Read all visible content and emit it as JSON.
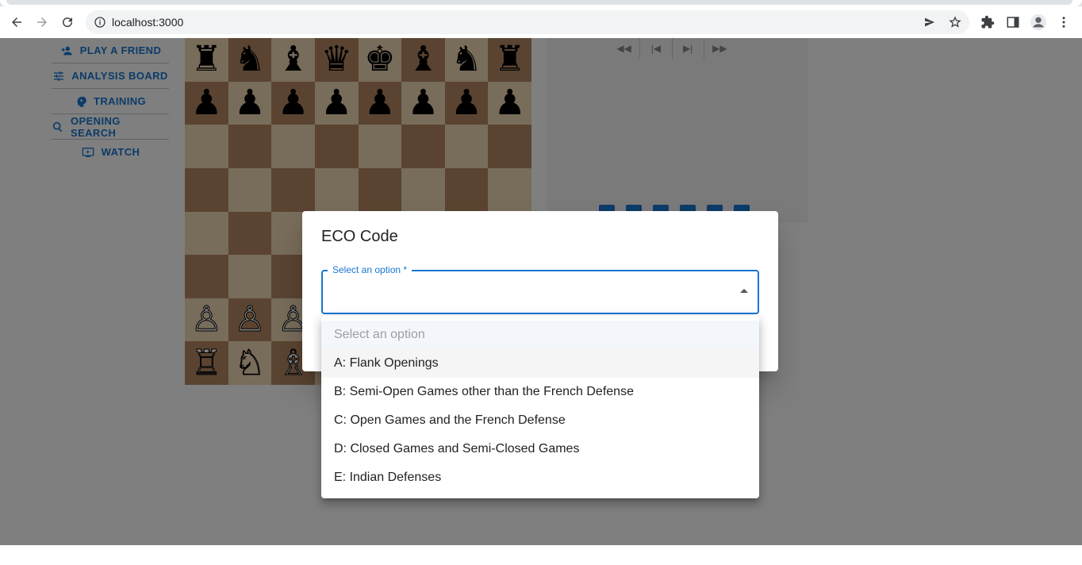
{
  "browser": {
    "url": "localhost:3000"
  },
  "sidebar": {
    "items": [
      {
        "label": "PLAY A FRIEND",
        "icon": "person-add-icon"
      },
      {
        "label": "ANALYSIS BOARD",
        "icon": "tune-icon"
      },
      {
        "label": "TRAINING",
        "icon": "psychology-icon"
      },
      {
        "label": "OPENING SEARCH",
        "icon": "search-icon"
      },
      {
        "label": "WATCH",
        "icon": "ondemand-video-icon"
      }
    ]
  },
  "board": {
    "light_color": "#f0d9b5",
    "dark_color": "#b58863",
    "rows": [
      [
        "♜",
        "♞",
        "♝",
        "♛",
        "♚",
        "♝",
        "♞",
        "♜"
      ],
      [
        "♟",
        "♟",
        "♟",
        "♟",
        "♟",
        "♟",
        "♟",
        "♟"
      ],
      [
        "",
        "",
        "",
        "",
        "",
        "",
        "",
        ""
      ],
      [
        "",
        "",
        "",
        "",
        "",
        "",
        "",
        ""
      ],
      [
        "",
        "",
        "",
        "",
        "",
        "",
        "",
        ""
      ],
      [
        "",
        "",
        "",
        "",
        "",
        "",
        "",
        ""
      ],
      [
        "♙",
        "♙",
        "♙",
        "♙",
        "♙",
        "♙",
        "♙",
        "♙"
      ],
      [
        "♖",
        "♘",
        "♗",
        "♕",
        "♔",
        "♗",
        "♘",
        "♖"
      ]
    ]
  },
  "dialog": {
    "title": "ECO Code",
    "field_label": "Select an option *",
    "options": [
      "Select an option",
      "A: Flank Openings",
      "B: Semi-Open Games other than the French Defense",
      "C: Open Games and the French Defense",
      "D: Closed Games and Semi-Closed Games",
      "E: Indian Defenses"
    ]
  },
  "colors": {
    "accent": "#1976d2",
    "backdrop": "rgba(0,0,0,0.5)"
  }
}
